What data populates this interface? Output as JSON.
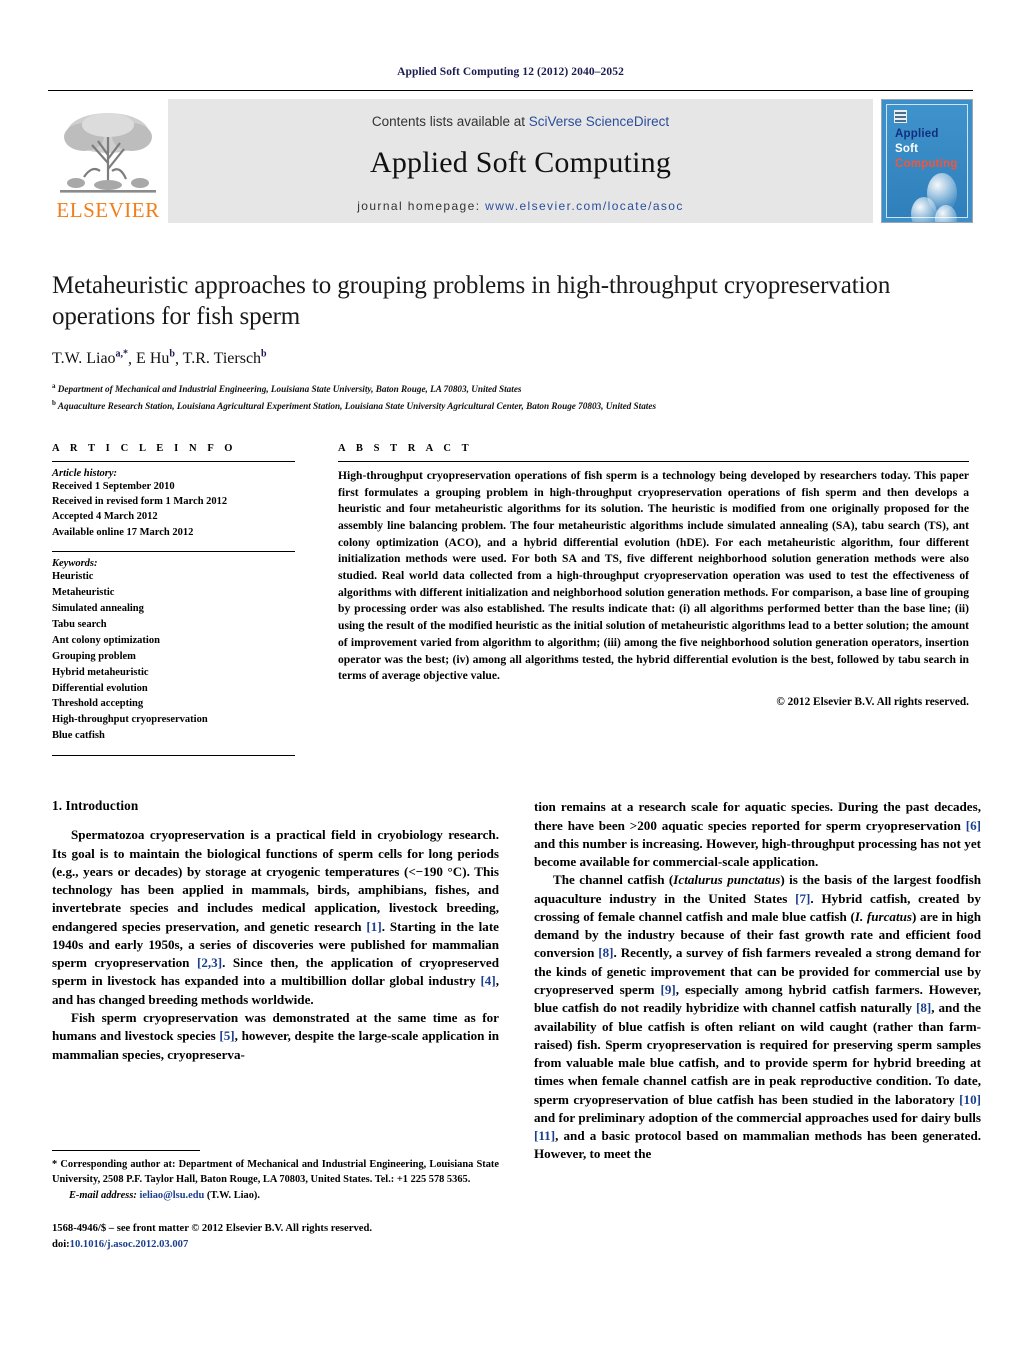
{
  "running_head": "Applied Soft Computing 12 (2012) 2040–2052",
  "masthead": {
    "contents_prefix": "Contents lists available at ",
    "contents_link": "SciVerse ScienceDirect",
    "journal_title": "Applied Soft Computing",
    "homepage_prefix": "journal homepage: ",
    "homepage_url": "www.elsevier.com/locate/asoc",
    "publisher_word": "ELSEVIER",
    "cover": {
      "line1": "Applied",
      "line2": "Soft",
      "line3": "Computing"
    }
  },
  "title": "Metaheuristic approaches to grouping problems in high-throughput cryopreservation operations for fish sperm",
  "authors": "T.W. Liao",
  "authors_full": "T.W. Liao<sup>a,*</sup>, E Hu<sup>b</sup>, T.R. Tiersch<sup>b</sup>",
  "affiliations": [
    "Department of Mechanical and Industrial Engineering, Louisiana State University, Baton Rouge, LA 70803, United States",
    "Aquaculture Research Station, Louisiana Agricultural Experiment Station, Louisiana State University Agricultural Center, Baton Rouge 70803, United States"
  ],
  "article_info": {
    "heading": "A R T I C L E    I N F O",
    "history_label": "Article history:",
    "history": [
      "Received 1 September 2010",
      "Received in revised form 1 March 2012",
      "Accepted 4 March 2012",
      "Available online 17 March 2012"
    ],
    "keywords_label": "Keywords:",
    "keywords": [
      "Heuristic",
      "Metaheuristic",
      "Simulated annealing",
      "Tabu search",
      "Ant colony optimization",
      "Grouping problem",
      "Hybrid metaheuristic",
      "Differential evolution",
      "Threshold accepting",
      "High-throughput cryopreservation",
      "Blue catfish"
    ]
  },
  "abstract": {
    "heading": "A B S T R A C T",
    "text": "High-throughput cryopreservation operations of fish sperm is a technology being developed by researchers today. This paper first formulates a grouping problem in high-throughput cryopreservation operations of fish sperm and then develops a heuristic and four metaheuristic algorithms for its solution. The heuristic is modified from one originally proposed for the assembly line balancing problem. The four metaheuristic algorithms include simulated annealing (SA), tabu search (TS), ant colony optimization (ACO), and a hybrid differential evolution (hDE). For each metaheuristic algorithm, four different initialization methods were used. For both SA and TS, five different neighborhood solution generation methods were also studied. Real world data collected from a high-throughput cryopreservation operation was used to test the effectiveness of algorithms with different initialization and neighborhood solution generation methods. For comparison, a base line of grouping by processing order was also established. The results indicate that: (i) all algorithms performed better than the base line; (ii) using the result of the modified heuristic as the initial solution of metaheuristic algorithms lead to a better solution; the amount of improvement varied from algorithm to algorithm; (iii) among the five neighborhood solution generation operators, insertion operator was the best; (iv) among all algorithms tested, the hybrid differential evolution is the best, followed by tabu search in terms of average objective value.",
    "copyright": "© 2012 Elsevier B.V. All rights reserved."
  },
  "section": {
    "number_title": "1.  Introduction"
  },
  "left_column": {
    "p1_a": "Spermatozoa cryopreservation is a practical field in cryobiology research. Its goal is to maintain the biological functions of sperm cells for long periods (e.g., years or decades) by storage at cryogenic temperatures (<−190 °C). This technology has been applied in mammals, birds, amphibians, fishes, and invertebrate species and includes medical application, livestock breeding, endangered species preservation, and genetic research ",
    "p1_r1": "[1]",
    "p1_b": ". Starting in the late 1940s and early 1950s, a series of discoveries were published for mammalian sperm cryopreservation ",
    "p1_r2": "[2,3]",
    "p1_c": ". Since then, the application of cryopreserved sperm in livestock has expanded into a multibillion dollar global industry ",
    "p1_r3": "[4]",
    "p1_d": ", and has changed breeding methods worldwide.",
    "p2_a": "Fish sperm cryopreservation was demonstrated at the same time as for humans and livestock species ",
    "p2_r1": "[5]",
    "p2_b": ", however, despite the large-scale application in mammalian species, cryopreserva-"
  },
  "right_column": {
    "p1_a": "tion remains at a research scale for aquatic species. During the past decades, there have been >200 aquatic species reported for sperm cryopreservation ",
    "p1_r1": "[6]",
    "p1_b": " and this number is increasing. However, high-throughput processing has not yet become available for commercial-scale application.",
    "p2_a": "The channel catfish (",
    "p2_i1": "Ictalurus punctatus",
    "p2_b": ") is the basis of the largest foodfish aquaculture industry in the United States ",
    "p2_r1": "[7]",
    "p2_c": ". Hybrid catfish, created by crossing of female channel catfish and male blue catfish (",
    "p2_i2": "I. furcatus",
    "p2_d": ") are in high demand by the industry because of their fast growth rate and efficient food conversion ",
    "p2_r2": "[8]",
    "p2_e": ". Recently, a survey of fish farmers revealed a strong demand for the kinds of genetic improvement that can be provided for commercial use by cryopreserved sperm ",
    "p2_r3": "[9]",
    "p2_f": ", especially among hybrid catfish farmers. However, blue catfish do not readily hybridize with channel catfish naturally ",
    "p2_r4": "[8]",
    "p2_g": ", and the availability of blue catfish is often reliant on wild caught (rather than farm-raised) fish. Sperm cryopreservation is required for preserving sperm samples from valuable male blue catfish, and to provide sperm for hybrid breeding at times when female channel catfish are in peak reproductive condition. To date, sperm cryopreservation of blue catfish has been studied in the laboratory ",
    "p2_r5": "[10]",
    "p2_h": " and for preliminary adoption of the commercial approaches used for dairy bulls ",
    "p2_r6": "[11]",
    "p2_i": ", and a basic protocol based on mammalian methods has been generated. However, to meet the"
  },
  "footnote": {
    "corresponding_a": "* Corresponding author at: Department of Mechanical and Industrial Engineering, Louisiana State University, 2508 P.F. Taylor Hall, Baton Rouge, LA 70803, United States. Tel.: +1 225 578 5365.",
    "email_label": "E-mail address:",
    "email": "ieliao@lsu.edu",
    "email_suffix": " (T.W. Liao).",
    "issn_line": "1568-4946/$ – see front matter © 2012 Elsevier B.V. All rights reserved.",
    "doi_prefix": "doi:",
    "doi": "10.1016/j.asoc.2012.03.007"
  },
  "colors": {
    "link_blue": "#2b4e9b",
    "ref_blue": "#1b3f8f",
    "elsevier_orange": "#f07f1a",
    "masthead_gray": "#e6e6e6",
    "cover_blue": "#3d8fc9"
  }
}
